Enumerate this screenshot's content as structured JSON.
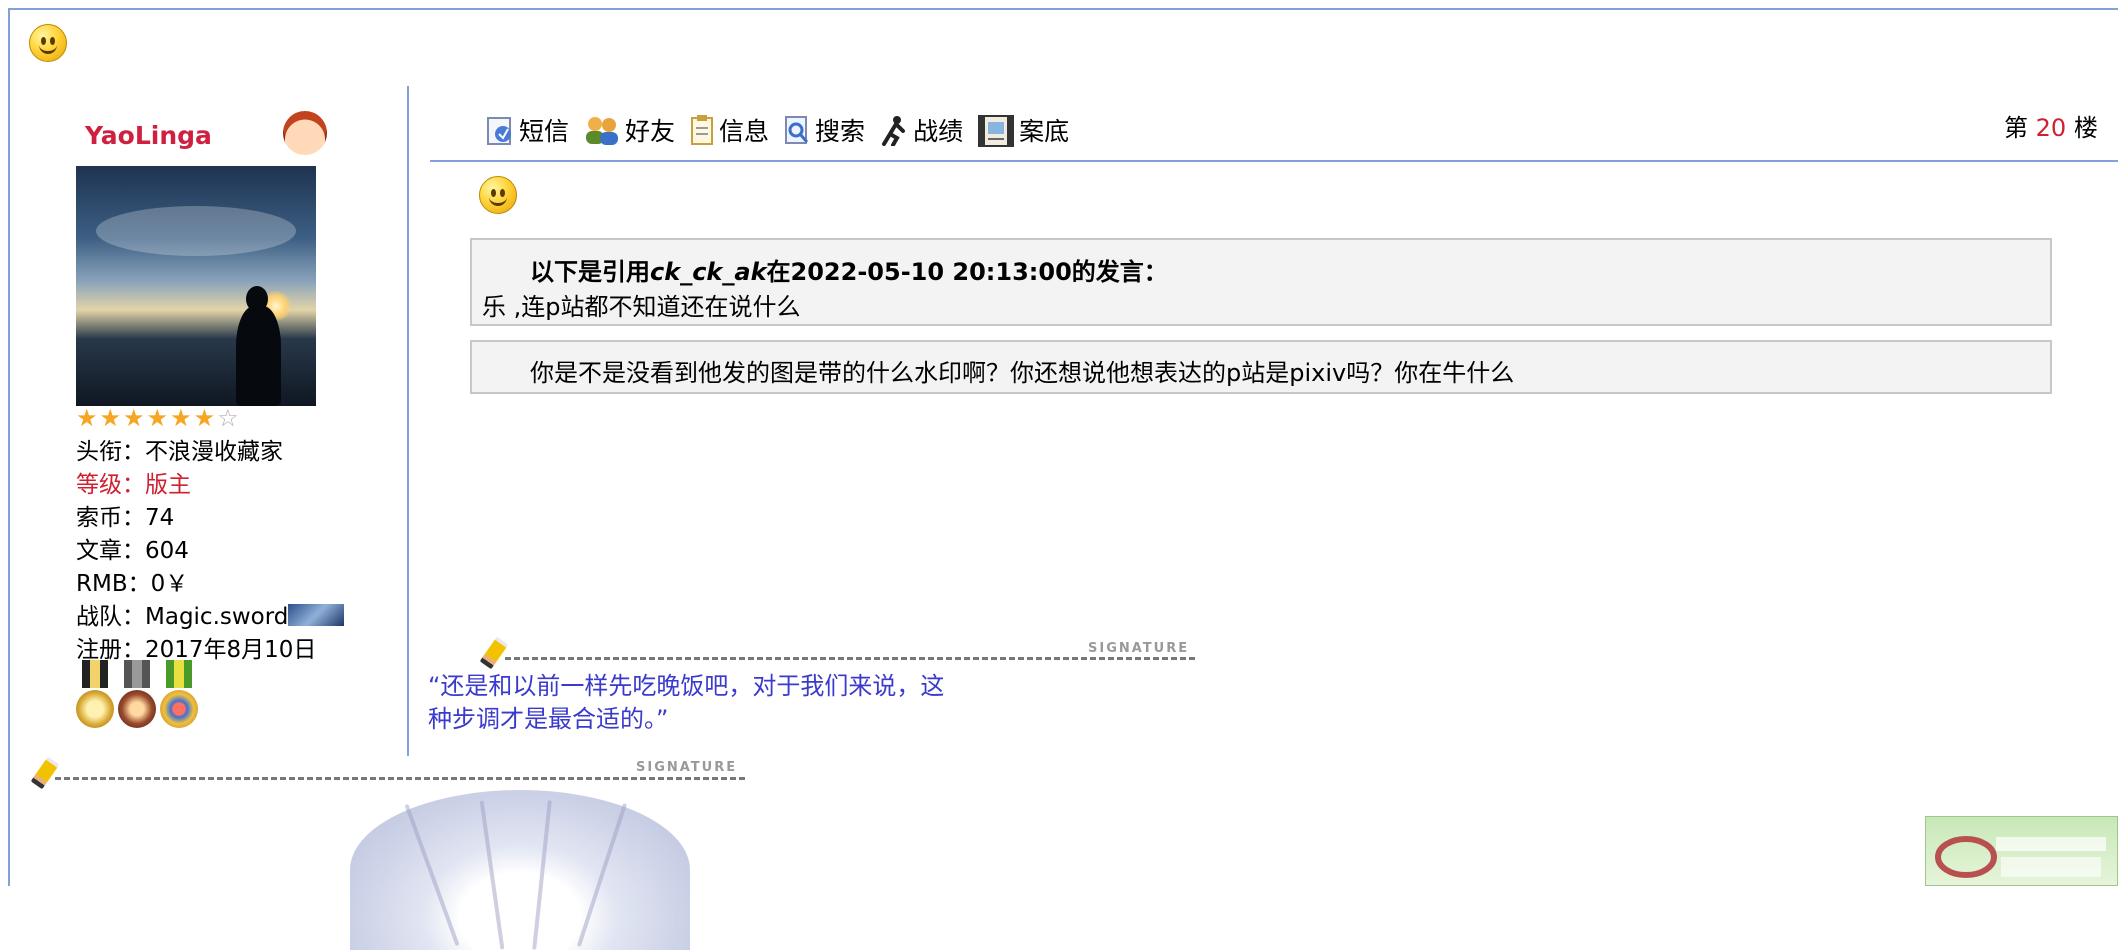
{
  "post": {
    "floor_prefix": "第",
    "floor_number": "20",
    "floor_suffix": "楼"
  },
  "author": {
    "username": "YaoLinga",
    "stars_total": 7,
    "stars_filled": 6,
    "title_label": "头衔：",
    "title_value": "不浪漫收藏家",
    "level_label": "等级：",
    "level_value": "版主",
    "coins_label": "索币：",
    "coins_value": "74",
    "posts_label": "文章：",
    "posts_value": "604",
    "rmb_label": "RMB：",
    "rmb_value": "0￥",
    "team_label": "战队：",
    "team_value": "Magic.sword",
    "registered_label": "注册：",
    "registered_value": "2017年8月10日",
    "medals": [
      "medal-1",
      "medal-2",
      "medal-3"
    ]
  },
  "toolbar": {
    "items": [
      {
        "label": "短信",
        "icon": "message-icon"
      },
      {
        "label": "好友",
        "icon": "friends-icon"
      },
      {
        "label": "信息",
        "icon": "info-icon"
      },
      {
        "label": "搜索",
        "icon": "search-icon"
      },
      {
        "label": "战绩",
        "icon": "record-icon"
      },
      {
        "label": "案底",
        "icon": "file-icon"
      }
    ]
  },
  "quote": {
    "intro": "以下是引用",
    "quoted_user": "ck_ck_ak",
    "in_text": "在",
    "datetime": "2022-05-10 20:13:00",
    "suffix": "的发言：",
    "body": "乐 ,连p站都不知道还在说什么"
  },
  "reply": {
    "text": "你是不是没看到他发的图是带的什么水印啊？你还想说他想表达的p站是pixiv吗？你在牛什么"
  },
  "signature": {
    "tag": "SIGNATURE",
    "text": "“还是和以前一样先吃晚饭吧，对于我们来说，这种步调才是最合适的。”"
  },
  "colors": {
    "username": "#d02040",
    "rule": "#7fa0d8",
    "signature_text": "#3a3acc",
    "floor_number": "#d02030"
  }
}
